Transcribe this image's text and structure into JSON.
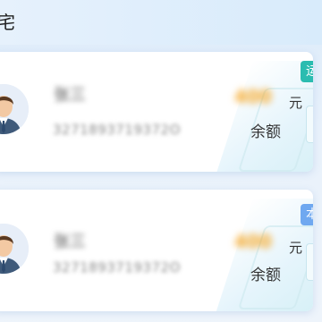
{
  "header": {
    "title": "宅"
  },
  "cards": [
    {
      "name": "张三",
      "number": "3271893719372O",
      "amount": "400",
      "unit": "元",
      "balance_label": "余额",
      "tag": "运",
      "tag_color": "#2bbcb0"
    },
    {
      "name": "张三",
      "number": "3271893719372O",
      "amount": "400",
      "unit": "元",
      "balance_label": "余额",
      "tag": "本",
      "tag_color": "#6fa8f0"
    }
  ],
  "icons": {
    "avatar": "user-avatar-icon"
  }
}
